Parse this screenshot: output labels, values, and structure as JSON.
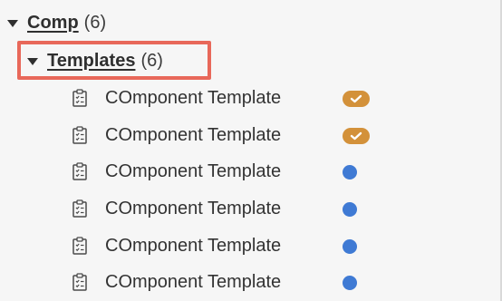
{
  "tree": {
    "root": {
      "label": "Comp",
      "count": "(6)"
    },
    "folder": {
      "label": "Templates",
      "count": "(6)",
      "highlight_color": "#e8685a"
    },
    "items": [
      {
        "label": "COmponent Template",
        "status": "checked",
        "status_color": "#d3913a",
        "icon": "template-icon"
      },
      {
        "label": "COmponent Template",
        "status": "checked",
        "status_color": "#d3913a",
        "icon": "template-icon"
      },
      {
        "label": "COmponent Template",
        "status": "dot",
        "status_color": "#3f7ad4",
        "icon": "template-icon"
      },
      {
        "label": "COmponent Template",
        "status": "dot",
        "status_color": "#3f7ad4",
        "icon": "template-icon"
      },
      {
        "label": "COmponent Template",
        "status": "dot",
        "status_color": "#3f7ad4",
        "icon": "template-icon"
      },
      {
        "label": "COmponent Template",
        "status": "dot",
        "status_color": "#3f7ad4",
        "icon": "template-icon"
      }
    ]
  }
}
